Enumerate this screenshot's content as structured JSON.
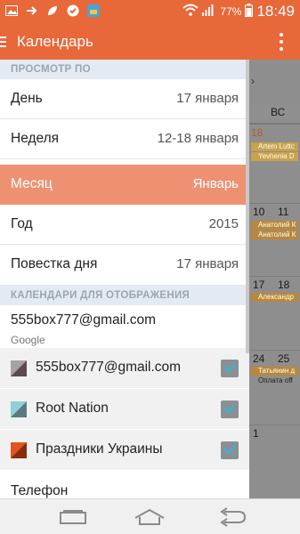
{
  "status_bar": {
    "battery_percent": "77%",
    "time": "18:49",
    "icons": [
      "image-icon",
      "forward-arrow-icon",
      "leaf-icon",
      "check-shield-icon",
      "app-icon",
      "wifi-icon",
      "signal-icon",
      "battery-icon"
    ]
  },
  "toolbar": {
    "title": "Календарь",
    "menu_icon": "hamburger-icon",
    "overflow_icon": "overflow-menu-icon"
  },
  "view_section": {
    "header": "ПРОСМОТР ПО",
    "items": [
      {
        "label": "День",
        "value": "17 января"
      },
      {
        "label": "Неделя",
        "value": "12-18 января"
      },
      {
        "label": "Месяц",
        "value": "Январь"
      },
      {
        "label": "Год",
        "value": "2015"
      },
      {
        "label": "Повестка дня",
        "value": "17 января"
      }
    ],
    "selected_index": 2
  },
  "calendars_section": {
    "header": "КАЛЕНДАРИ ДЛЯ ОТОБРАЖЕНИЯ",
    "account": {
      "email": "555box777@gmail.com",
      "type": "Google"
    },
    "calendars": [
      {
        "name": "555box777@gmail.com",
        "color_a": "#a8a2a6",
        "color_b": "#5c4a52",
        "checked": true
      },
      {
        "name": "Root Nation",
        "color_a": "#8fd0d8",
        "color_b": "#5b7a80",
        "checked": true
      },
      {
        "name": "Праздники Украины",
        "color_a": "#e0551f",
        "color_b": "#8a2a10",
        "checked": true
      }
    ],
    "next_account_label": "Телефон"
  },
  "background_calendar": {
    "day_header": "ВС",
    "weeks": [
      {
        "day": "18",
        "events": [
          "Artem Luttc",
          "Yevhenia D"
        ]
      },
      {
        "day": "10",
        "day2": "11",
        "events": [
          "Анатолий К",
          "Анатолий К"
        ]
      },
      {
        "day": "17",
        "day2": "18",
        "events": [
          "Александр"
        ]
      },
      {
        "day": "24",
        "day2": "25",
        "events": [
          "Татьянин д",
          "Оплата off"
        ]
      },
      {
        "day": "1",
        "events": []
      }
    ]
  },
  "nav_bar": {
    "buttons": [
      "recent-apps-icon",
      "home-icon",
      "back-icon"
    ]
  },
  "colors": {
    "accent": "#e8683a",
    "selected_row": "#ee9172",
    "section_header_bg": "#e4eaf1",
    "checkbox_tick": "#2fb6e0"
  }
}
